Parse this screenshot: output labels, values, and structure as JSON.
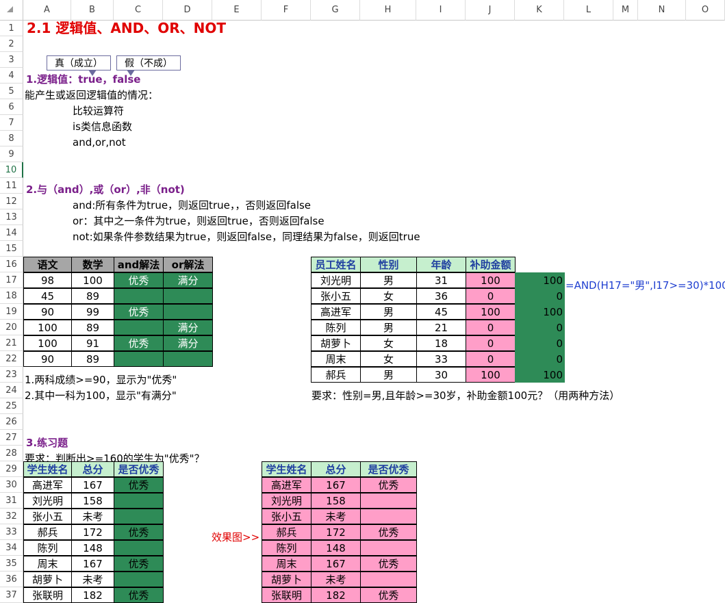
{
  "columns": [
    "A",
    "B",
    "C",
    "D",
    "E",
    "F",
    "G",
    "H",
    "I",
    "J",
    "K",
    "L",
    "M",
    "N",
    "O"
  ],
  "rows": [
    "1",
    "2",
    "3",
    "4",
    "5",
    "6",
    "7",
    "8",
    "9",
    "10",
    "11",
    "12",
    "13",
    "14",
    "15",
    "16",
    "17",
    "18",
    "19",
    "20",
    "21",
    "22",
    "23",
    "24",
    "25",
    "26",
    "27",
    "28",
    "29",
    "30",
    "31",
    "32",
    "33",
    "34",
    "35",
    "36",
    "37"
  ],
  "title": "2.1 逻辑值、AND、OR、NOT",
  "callouts": {
    "true_box": "真（成立）",
    "false_box": "假（不成）"
  },
  "section1": {
    "heading": "1.逻辑值：true，false",
    "intro": "能产生或返回逻辑值的情况：",
    "items": [
      "比较运算符",
      "is类信息函数",
      "and,or,not"
    ]
  },
  "section2": {
    "heading": "2.与（and）,或（or）,非（not)",
    "items": [
      "and:所有条件为true，则返回true，，否则返回false",
      "or：其中之一条件为true，则返回true，否则返回false",
      "not:如果条件参数结果为true，则返回false，同理结果为false，则返回true"
    ]
  },
  "table1": {
    "headers": [
      "语文",
      "数学",
      "and解法",
      "or解法"
    ],
    "rows": [
      [
        "98",
        "100",
        "优秀",
        "满分"
      ],
      [
        "45",
        "89",
        "",
        ""
      ],
      [
        "90",
        "99",
        "优秀",
        ""
      ],
      [
        "100",
        "89",
        "",
        "满分"
      ],
      [
        "100",
        "91",
        "优秀",
        "满分"
      ],
      [
        "90",
        "89",
        "",
        ""
      ]
    ],
    "notes": [
      "1.两科成绩>=90，显示为\"优秀\"",
      "2.其中一科为100，显示\"有满分\""
    ]
  },
  "table2": {
    "headers": [
      "员工姓名",
      "性别",
      "年龄",
      "补助金额"
    ],
    "rows": [
      [
        "刘光明",
        "男",
        "31",
        "100",
        "100"
      ],
      [
        "张小五",
        "女",
        "36",
        "0",
        "0"
      ],
      [
        "高进军",
        "男",
        "45",
        "100",
        "100"
      ],
      [
        "陈列",
        "男",
        "21",
        "0",
        "0"
      ],
      [
        "胡萝卜",
        "女",
        "18",
        "0",
        "0"
      ],
      [
        "周末",
        "女",
        "33",
        "0",
        "0"
      ],
      [
        "郝兵",
        "男",
        "30",
        "100",
        "100"
      ]
    ],
    "formula": "=AND(H17=\"男\",I17>=30)*100",
    "note": "要求：性别=男,且年龄>=30岁，补助金额100元？（用两种方法）"
  },
  "section3": {
    "heading": "3.练习题",
    "requirement": "要求：判断出>=160的学生为\"优秀\"？",
    "headers": [
      "学生姓名",
      "总分",
      "是否优秀"
    ],
    "rows": [
      [
        "高进军",
        "167",
        "优秀"
      ],
      [
        "刘光明",
        "158",
        ""
      ],
      [
        "张小五",
        "未考",
        ""
      ],
      [
        "郝兵",
        "172",
        "优秀"
      ],
      [
        "陈列",
        "148",
        ""
      ],
      [
        "周末",
        "167",
        "优秀"
      ],
      [
        "胡萝卜",
        "未考",
        ""
      ],
      [
        "张联明",
        "182",
        "优秀"
      ]
    ],
    "effect_label": "效果图>>"
  },
  "colors": {
    "green_fill": "#2e8b57",
    "pink_fill": "#ff9ec8",
    "header_gray": "#a6a6a6",
    "header_green": "#c6efce",
    "title_red": "#e00000",
    "heading_purple": "#7a1f8a",
    "formula_blue": "#1f3fd0"
  }
}
